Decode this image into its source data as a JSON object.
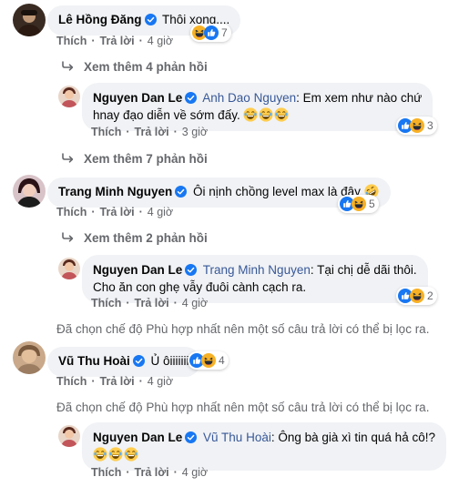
{
  "colors": {
    "link_blue": "#385898",
    "verified_blue": "#1877f2",
    "bubble_bg": "#f0f2f5",
    "meta_gray": "#65676b"
  },
  "actions": {
    "like": "Thích",
    "reply": "Trả lời",
    "dot": "·"
  },
  "comments": [
    {
      "author": "Lê Hồng Đăng",
      "text": "Thôi xong....",
      "time": "4 giờ",
      "reaction_icons": [
        "haha-icon",
        "like-icon"
      ],
      "reaction_count": "7",
      "more_replies": "Xem thêm 4 phản hồi",
      "reply": {
        "author": "Nguyen Dan Le",
        "mention": "Anh Dao Nguyen",
        "text_line1": ": Em xem như nào chứ",
        "text_line2": "hnay đạo diễn về sớm đấy.",
        "emojis": [
          "laughing-emoji",
          "laughing-emoji",
          "laughing-emoji"
        ],
        "time": "3 giờ",
        "reaction_icons": [
          "like-icon",
          "haha-icon"
        ],
        "reaction_count": "3"
      }
    },
    {
      "more_replies_before": "Xem thêm 7 phản hồi",
      "author": "Trang Minh Nguyen",
      "text": "Ôi nịnh chồng level max là đây",
      "emojis": [
        "rofl-emoji"
      ],
      "time": "4 giờ",
      "reaction_icons": [
        "like-icon",
        "haha-icon"
      ],
      "reaction_count": "5",
      "more_replies": "Xem thêm 2 phản hồi",
      "reply": {
        "author": "Nguyen Dan Le",
        "mention": "Trang Minh Nguyen",
        "text_line1": ": Tại chị dễ dãi thôi.",
        "text_line2": "Cho ăn con ghẹ vẫy đuôi cành cạch ra.",
        "time": "4 giờ",
        "reaction_icons": [
          "like-icon",
          "haha-icon"
        ],
        "reaction_count": "2"
      },
      "filter_note": "Đã chọn chế độ Phù hợp nhất nên một số câu trả lời có thể bị lọc ra."
    },
    {
      "author": "Vũ Thu Hoài",
      "text": "Ủ ôiiiiiii",
      "time": "4 giờ",
      "reaction_icons": [
        "like-icon",
        "haha-icon"
      ],
      "reaction_count": "4",
      "filter_note": "Đã chọn chế độ Phù hợp nhất nên một số câu trả lời có thể bị lọc ra.",
      "reply": {
        "author": "Nguyen Dan Le",
        "mention": "Vũ Thu Hoài",
        "text_line1": ": Ông bà già xì tin quá hả cô!?",
        "emojis": [
          "laughing-emoji",
          "laughing-emoji",
          "laughing-emoji"
        ],
        "time": "4 giờ"
      }
    }
  ]
}
